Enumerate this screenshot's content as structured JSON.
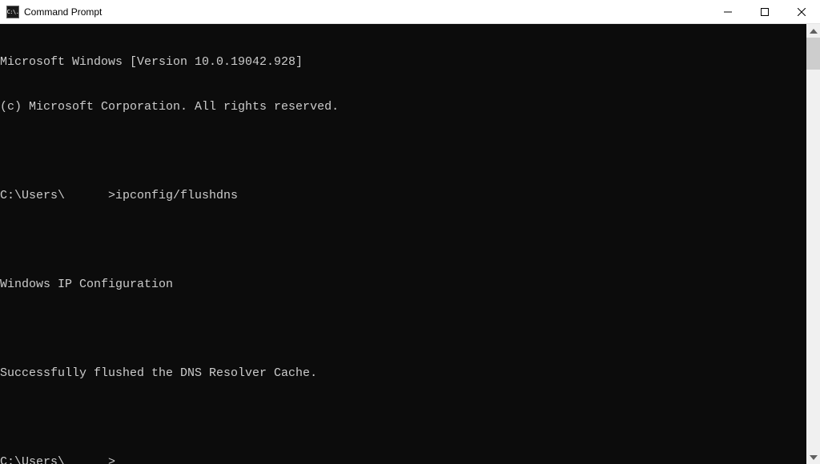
{
  "window": {
    "title": "Command Prompt",
    "icon_text": "C:\\."
  },
  "terminal": {
    "lines": [
      "Microsoft Windows [Version 10.0.19042.928]",
      "(c) Microsoft Corporation. All rights reserved.",
      "",
      "C:\\Users\\      >ipconfig/flushdns",
      "",
      "Windows IP Configuration",
      "",
      "Successfully flushed the DNS Resolver Cache.",
      "",
      "C:\\Users\\      >"
    ]
  }
}
